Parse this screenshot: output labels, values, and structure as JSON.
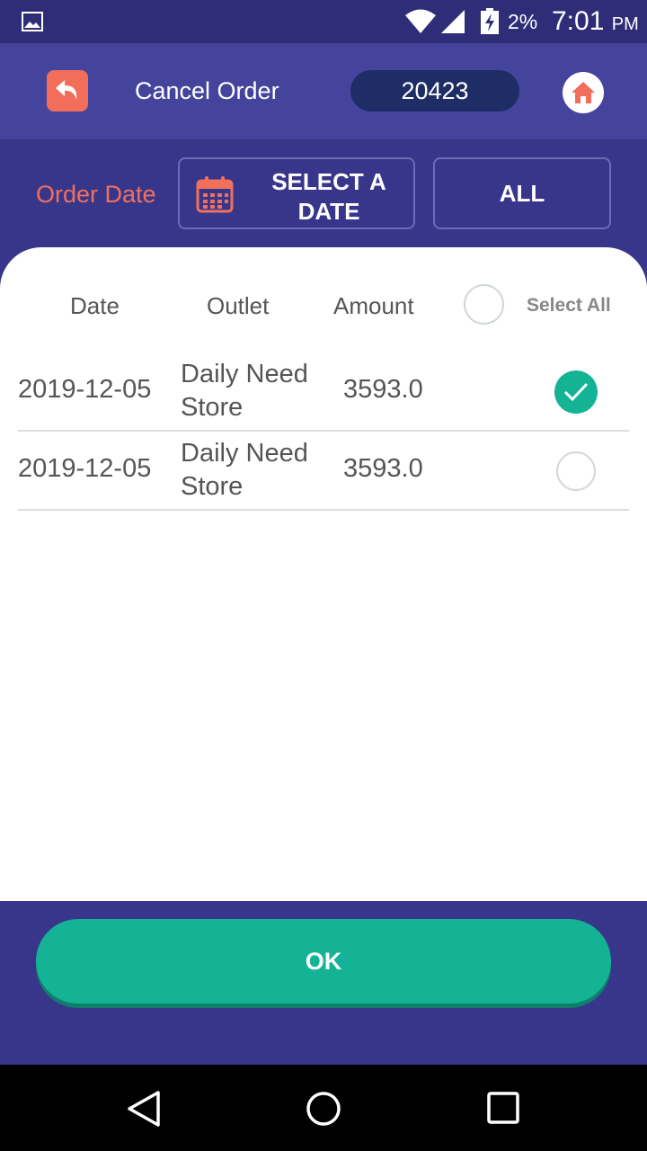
{
  "status_bar": {
    "battery": "2%",
    "time": "7:01",
    "ampm": "PM",
    "icons": [
      "image-icon",
      "wifi-icon",
      "signal-icon",
      "battery-charging-icon"
    ]
  },
  "header": {
    "title": "Cancel Order",
    "order_number": "20423",
    "back_icon": "undo-arrow-icon",
    "home_icon": "home-icon"
  },
  "filters": {
    "order_date_label": "Order Date",
    "select_date_label": "SELECT A DATE",
    "select_date_icon": "calendar-icon",
    "all_label": "ALL"
  },
  "table": {
    "columns": [
      "Date",
      "Outlet",
      "Amount"
    ],
    "select_all_label": "Select All",
    "select_all_checked": false,
    "rows": [
      {
        "date": "2019-12-05",
        "outlet": "Daily Need Store",
        "amount": "3593.0",
        "selected": true
      },
      {
        "date": "2019-12-05",
        "outlet": "Daily Need Store",
        "amount": "3593.0",
        "selected": false
      }
    ]
  },
  "ok_label": "OK",
  "colors": {
    "primary": "#38368a",
    "header": "#44449c",
    "accent": "#f26e5b",
    "success": "#14b395",
    "pill": "#1f2d66"
  },
  "nav": [
    "back-icon",
    "home-icon",
    "recents-icon"
  ]
}
